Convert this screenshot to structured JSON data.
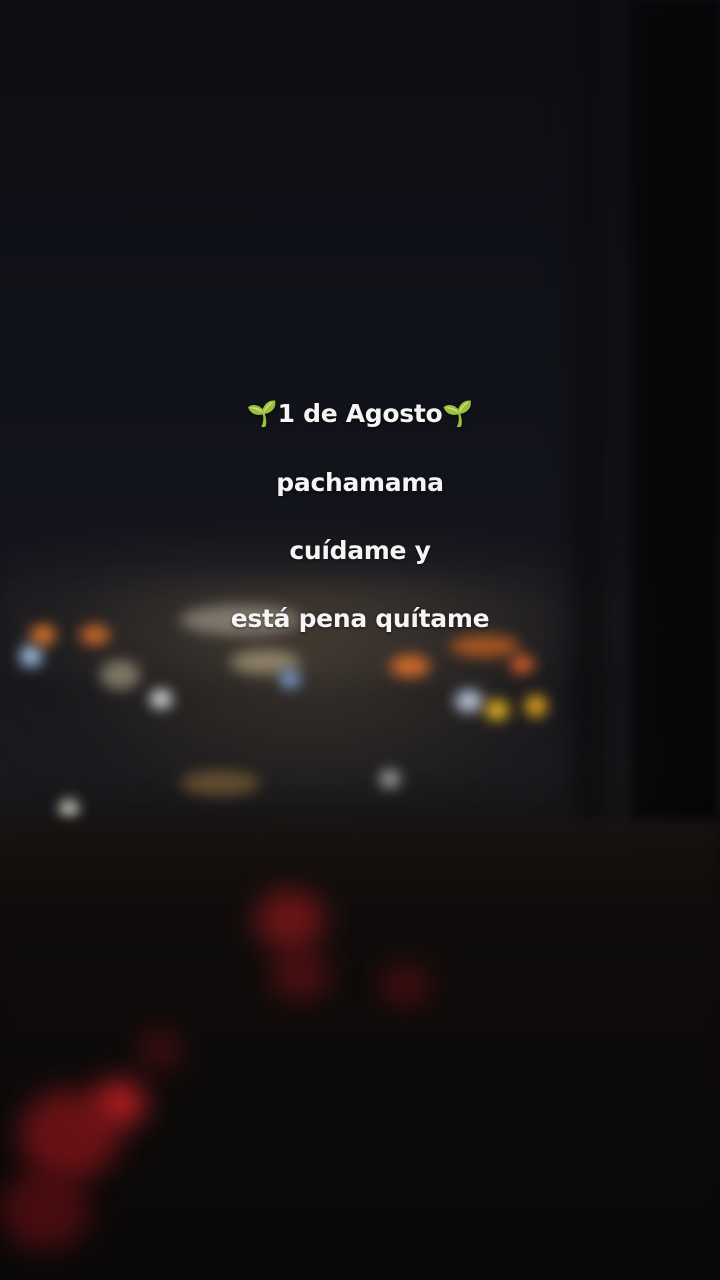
{
  "lyrics": {
    "line1": "🌱1 de Agosto🌱",
    "line2": "pachamama",
    "line3": "cuídame y",
    "line4": "está pena quítame"
  },
  "colors": {
    "text": "#f5f5f5",
    "background": "#0a0a0c"
  }
}
